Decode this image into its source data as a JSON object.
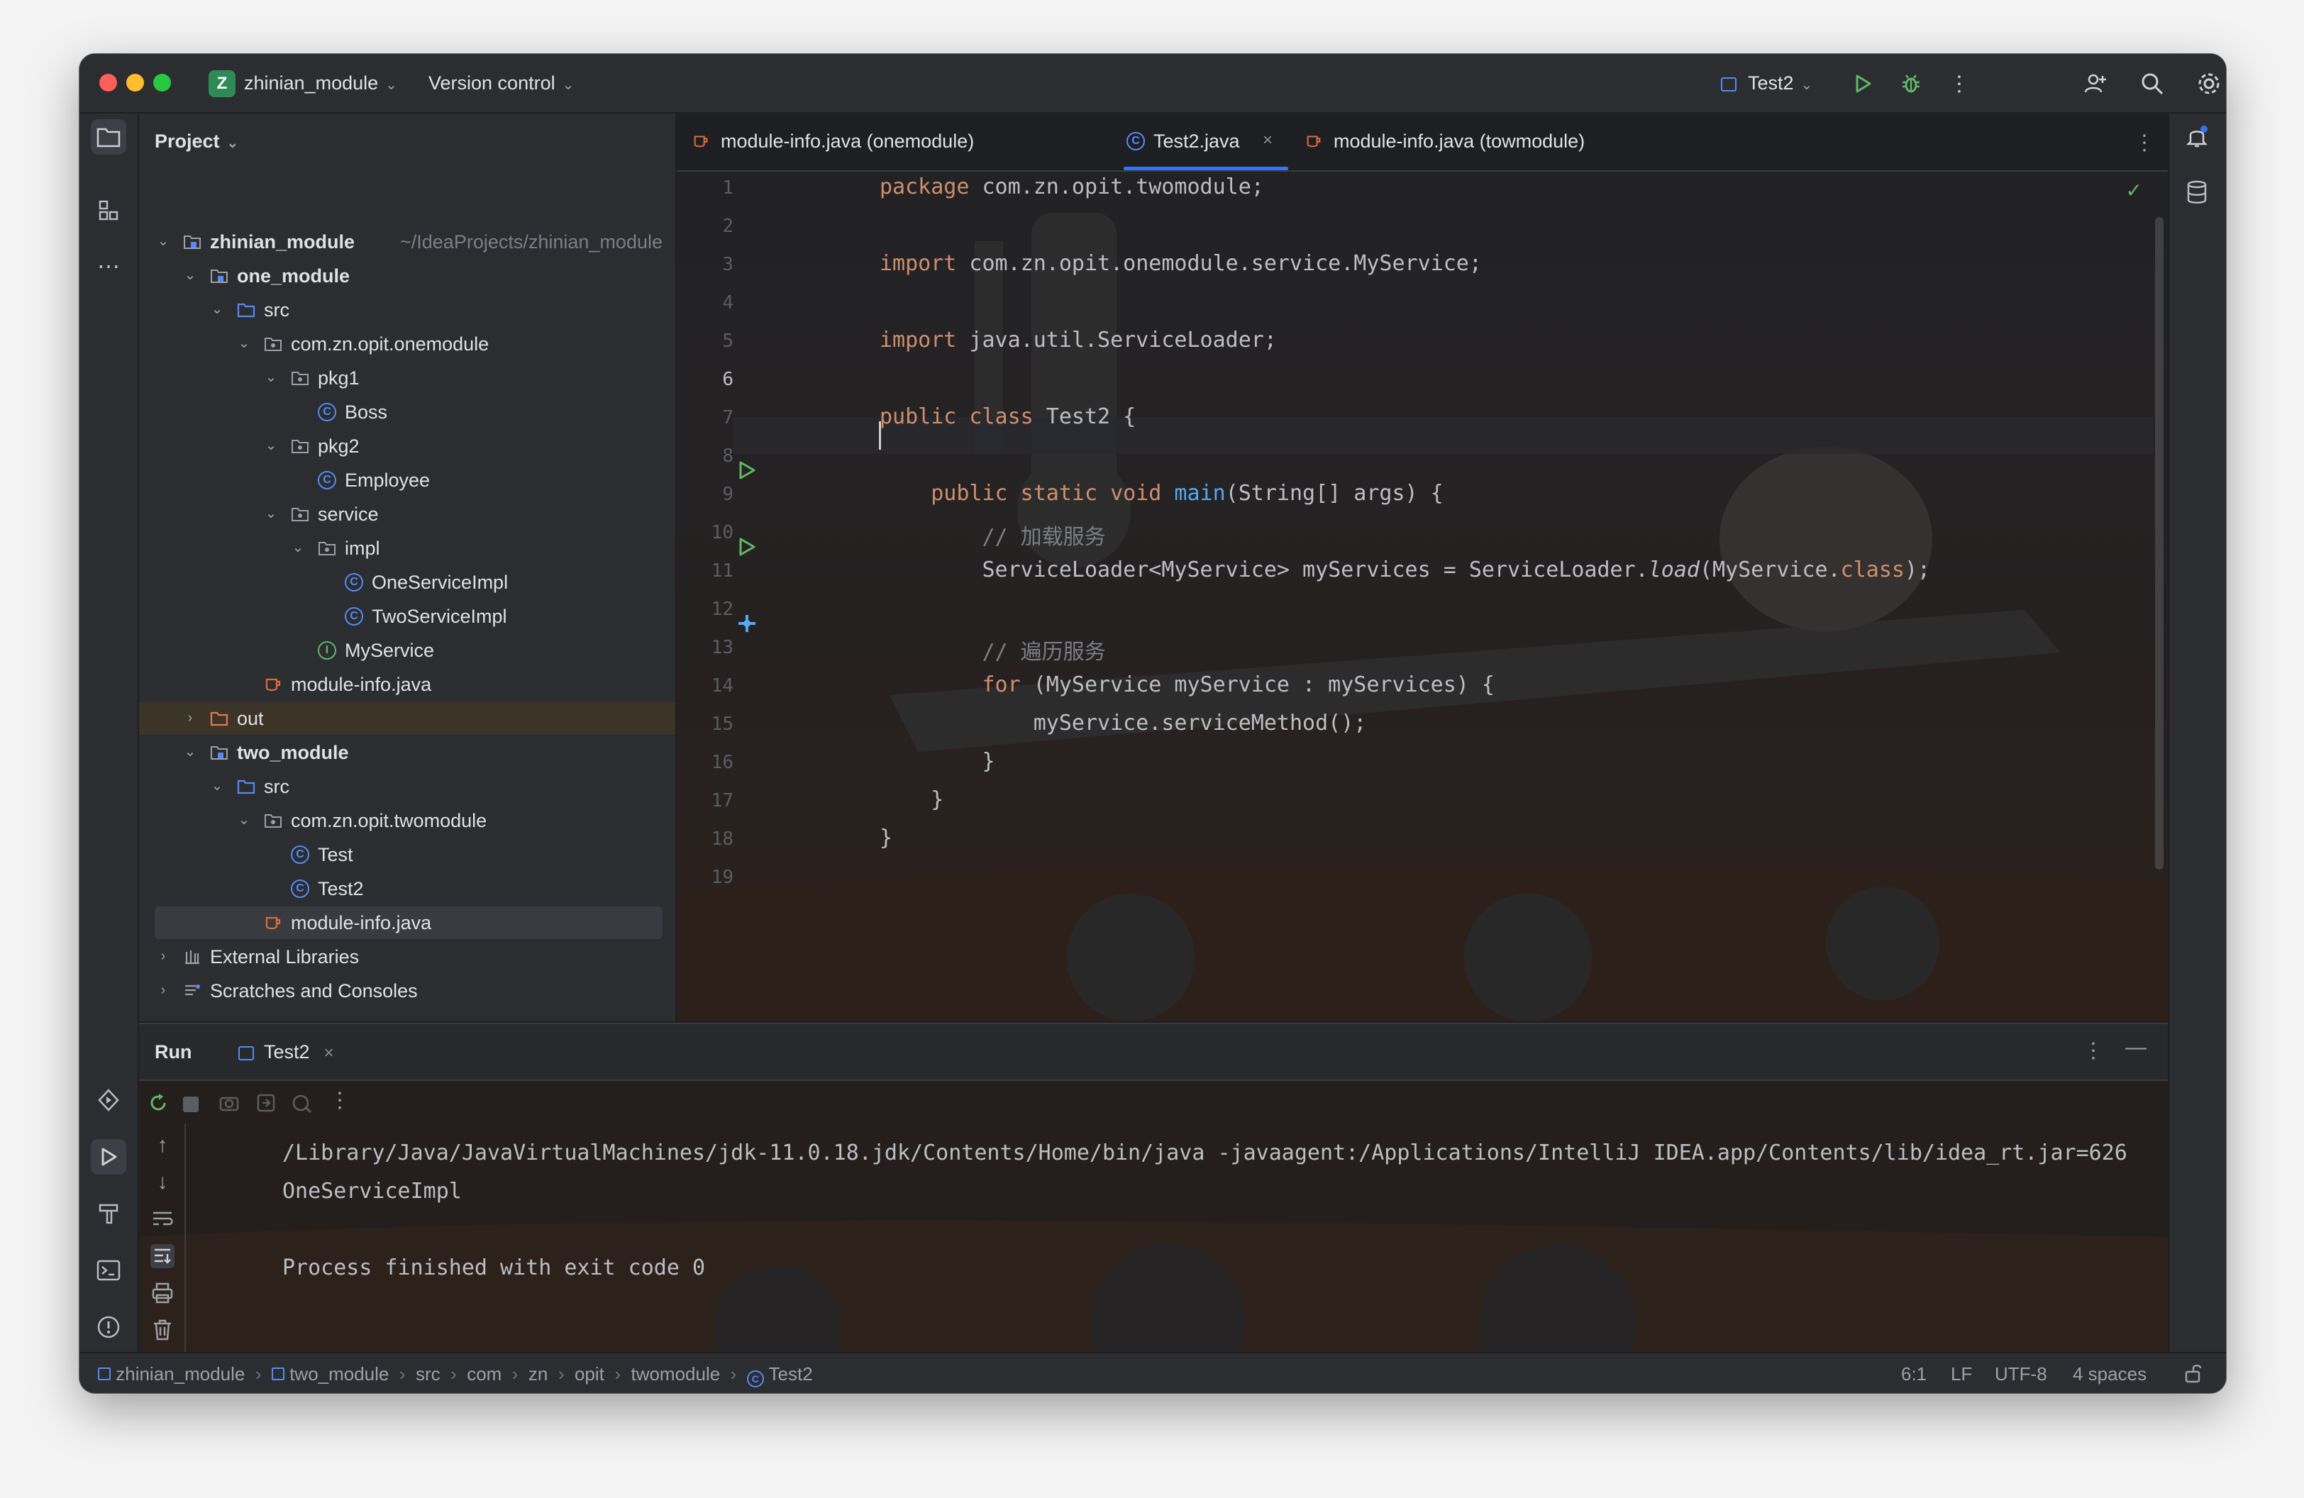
{
  "titlebar": {
    "project_badge": "Z",
    "project_name": "zhinian_module",
    "version_control": "Version control",
    "run_config": "Test2"
  },
  "project_panel": {
    "title": "Project",
    "tree": [
      {
        "label": "zhinian_module",
        "path": "~/IdeaProjects/zhinian_module"
      },
      {
        "label": "one_module"
      },
      {
        "label": "src"
      },
      {
        "label": "com.zn.opit.onemodule"
      },
      {
        "label": "pkg1"
      },
      {
        "label": "Boss"
      },
      {
        "label": "pkg2"
      },
      {
        "label": "Employee"
      },
      {
        "label": "service"
      },
      {
        "label": "impl"
      },
      {
        "label": "OneServiceImpl"
      },
      {
        "label": "TwoServiceImpl"
      },
      {
        "label": "MyService"
      },
      {
        "label": "module-info.java"
      },
      {
        "label": "out"
      },
      {
        "label": "two_module"
      },
      {
        "label": "src"
      },
      {
        "label": "com.zn.opit.twomodule"
      },
      {
        "label": "Test"
      },
      {
        "label": "Test2"
      },
      {
        "label": "module-info.java"
      },
      {
        "label": "External Libraries"
      },
      {
        "label": "Scratches and Consoles"
      }
    ]
  },
  "editor": {
    "tabs": [
      {
        "label": "module-info.java (onemodule)"
      },
      {
        "label": "Test2.java"
      },
      {
        "label": "module-info.java (towmodule)"
      }
    ],
    "line_numbers": [
      "1",
      "2",
      "3",
      "4",
      "5",
      "6",
      "7",
      "8",
      "9",
      "10",
      "11",
      "12",
      "13",
      "14",
      "15",
      "16",
      "17",
      "18",
      "19"
    ],
    "code": {
      "l1_kw": "package",
      "l1_rest": " com.zn.opit.twomodule;",
      "l3_kw": "import",
      "l3_rest": " com.zn.opit.onemodule.service.MyService;",
      "l5_kw": "import",
      "l5_rest": " java.util.ServiceLoader;",
      "l7_kw": "public class",
      "l7_rest": " Test2 {",
      "l9_kw": "    public static void ",
      "l9_fn": "main",
      "l9_rest": "(String[] args) {",
      "l10_cm": "        // 加载服务",
      "l11_a": "        ServiceLoader<MyService> myServices = ServiceLoader.",
      "l11_it": "load",
      "l11_b": "(MyService.",
      "l11_kw": "class",
      "l11_c": ");",
      "l13_cm": "        // 遍历服务",
      "l14_kw": "        for",
      "l14_rest": " (MyService myService : myServices) {",
      "l15": "            myService.serviceMethod();",
      "l16": "        }",
      "l17": "    }",
      "l18": "}"
    }
  },
  "run_panel": {
    "title": "Run",
    "tab": "Test2",
    "output": [
      "/Library/Java/JavaVirtualMachines/jdk-11.0.18.jdk/Contents/Home/bin/java -javaagent:/Applications/IntelliJ IDEA.app/Contents/lib/idea_rt.jar=626",
      "OneServiceImpl",
      "",
      "Process finished with exit code 0"
    ]
  },
  "statusbar": {
    "breadcrumbs": [
      "zhinian_module",
      "two_module",
      "src",
      "com",
      "zn",
      "opit",
      "twomodule",
      "Test2"
    ],
    "position": "6:1",
    "line_ending": "LF",
    "encoding": "UTF-8",
    "indent": "4 spaces"
  },
  "colors": {
    "accent": "#3574f0",
    "keyword": "#cf8e6d",
    "function": "#56a8f5",
    "comment": "#7a7e85",
    "run_green": "#5fb865"
  }
}
